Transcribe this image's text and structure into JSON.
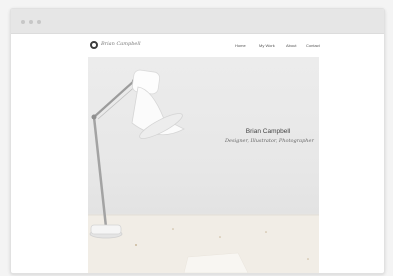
{
  "site": {
    "brand": "Brian Campbell",
    "nav": [
      "Home",
      "My Work",
      "About",
      "Contact"
    ]
  },
  "hero": {
    "name": "Brian Campbell",
    "tagline": "Designer, Illustrator, Photographer"
  }
}
